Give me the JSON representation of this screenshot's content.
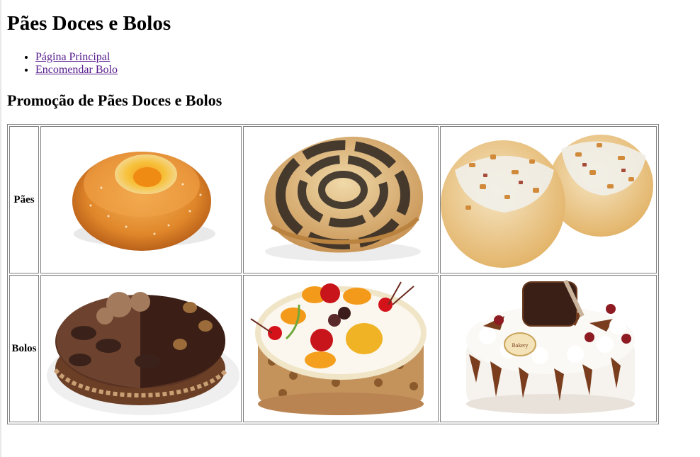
{
  "page": {
    "title": "Pães Doces e Bolos",
    "nav": [
      {
        "label": "Página Principal"
      },
      {
        "label": "Encomendar Bolo"
      }
    ],
    "section_title": "Promoção de Pães Doces e Bolos"
  },
  "table": {
    "rows": [
      {
        "label": "Pães",
        "items": [
          "danish-pastry-icon",
          "poppy-seed-roll-icon",
          "nut-topped-buns-icon"
        ]
      },
      {
        "label": "Bolos",
        "items": [
          "chocolate-cake-icon",
          "fruit-cake-icon",
          "black-forest-cake-icon"
        ]
      }
    ],
    "cake_badge": "Bakery"
  },
  "colors": {
    "link": "#551a8b",
    "border": "#808080"
  }
}
